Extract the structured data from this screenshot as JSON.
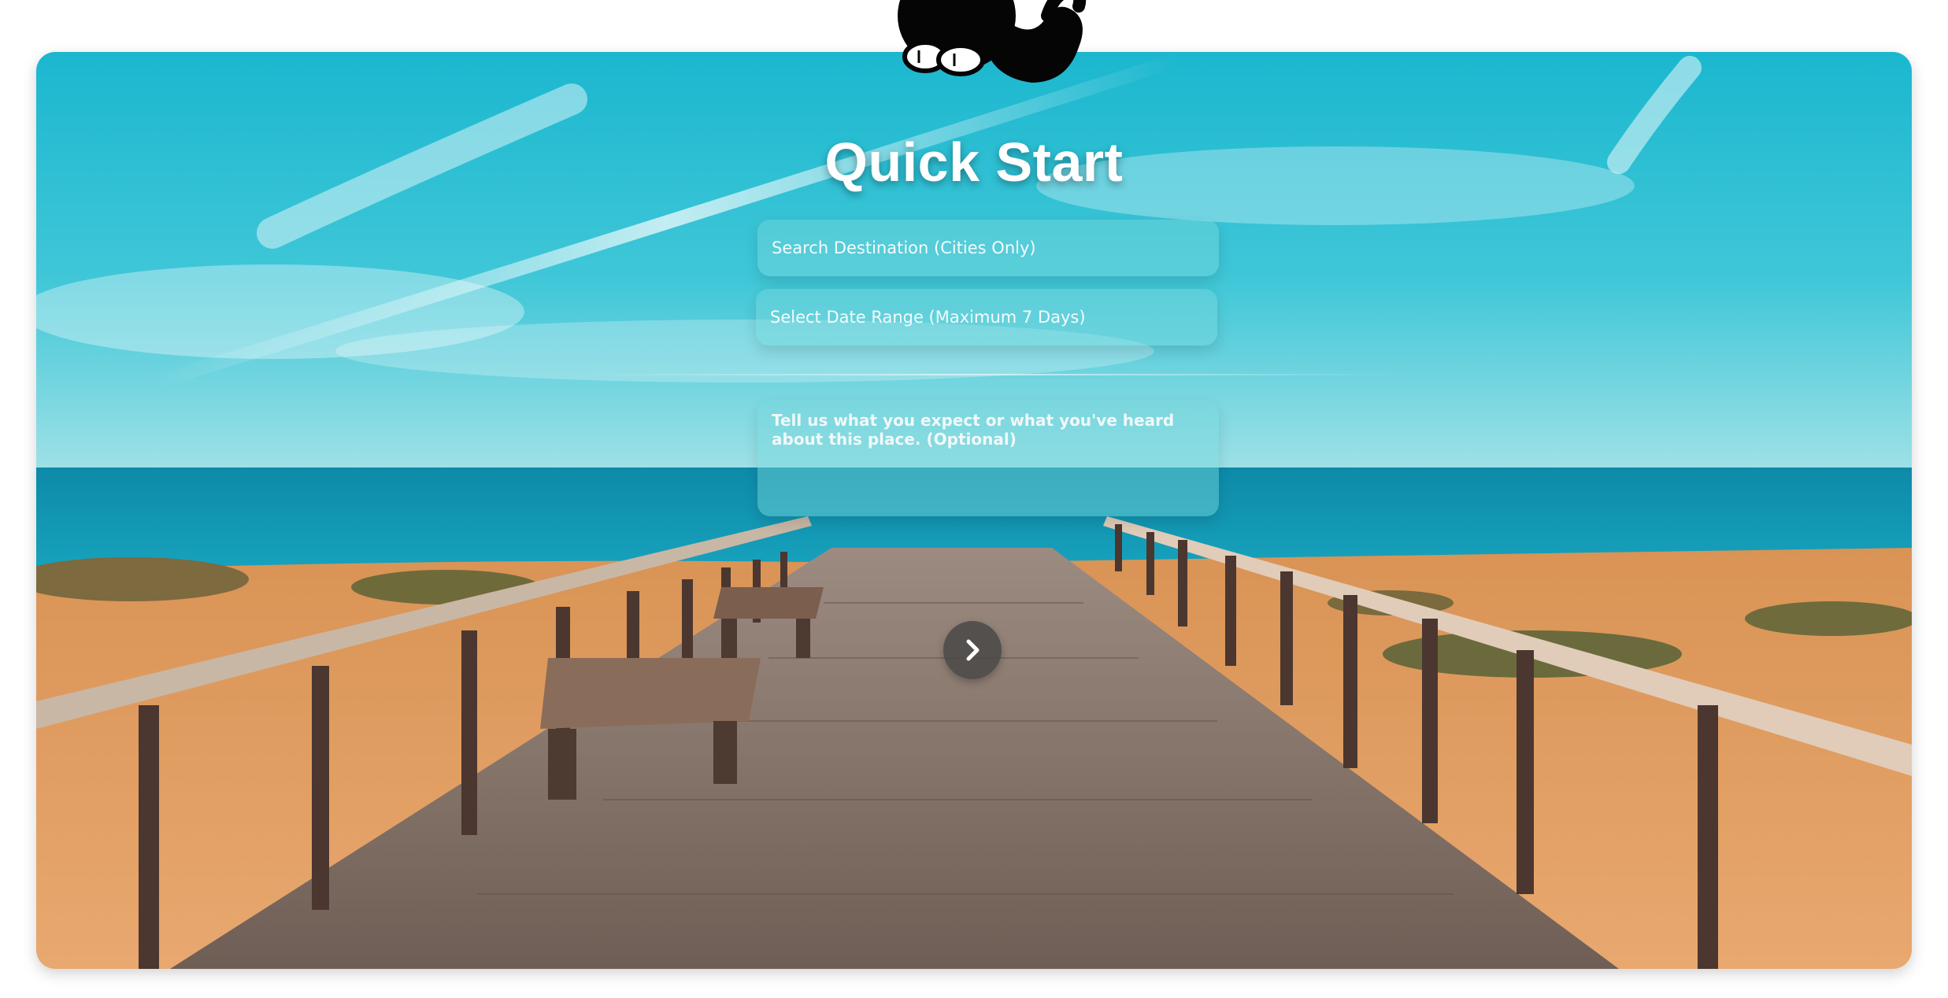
{
  "header": {
    "mascot_icon": "black-cat-icon"
  },
  "hero": {
    "title": "Quick Start",
    "background": "beach-boardwalk-photo",
    "colors": {
      "sky": "#2cc0d2",
      "sea": "#0f94b0",
      "sand": "#e39a5e",
      "deck": "#8d7a6e"
    }
  },
  "form": {
    "destination_placeholder": "Search Destination (Cities Only)",
    "date_range_placeholder": "Select Date Range (Maximum 7 Days)",
    "notes_placeholder": "Tell us what you expect or what you've heard about this place. (Optional)"
  },
  "actions": {
    "next_icon": "chevron-right-icon"
  }
}
